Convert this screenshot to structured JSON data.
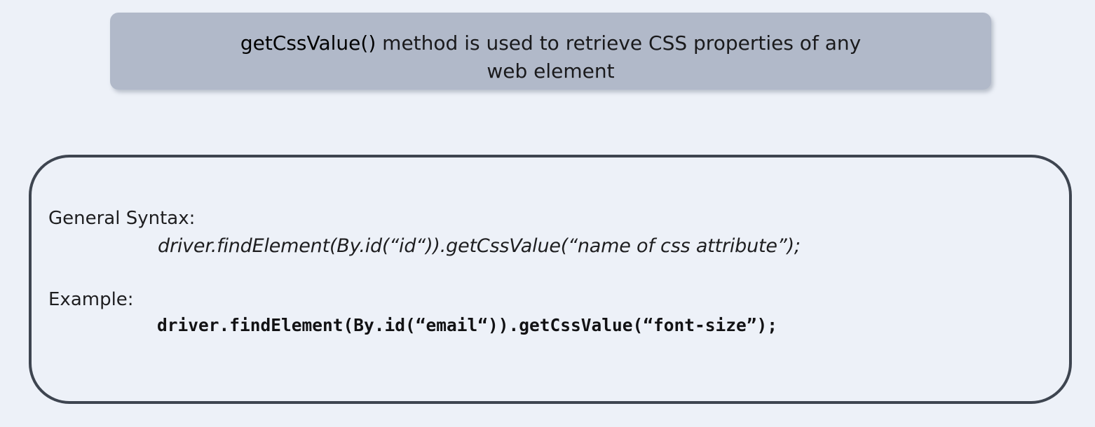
{
  "banner": {
    "method_name": "getCssValue()",
    "line1_rest": " method is used to retrieve CSS properties of any",
    "line2": "web element"
  },
  "syntax": {
    "label": "General Syntax:",
    "code": "driver.findElement(By.id(“id“)).getCssValue(“name of css attribute”);"
  },
  "example": {
    "label": "Example:",
    "code": "driver.findElement(By.id(“email“)).getCssValue(“font-size”);"
  },
  "colors": {
    "background": "#edf1f8",
    "banner": "#b1b9c9",
    "box_border": "#3e4550"
  }
}
